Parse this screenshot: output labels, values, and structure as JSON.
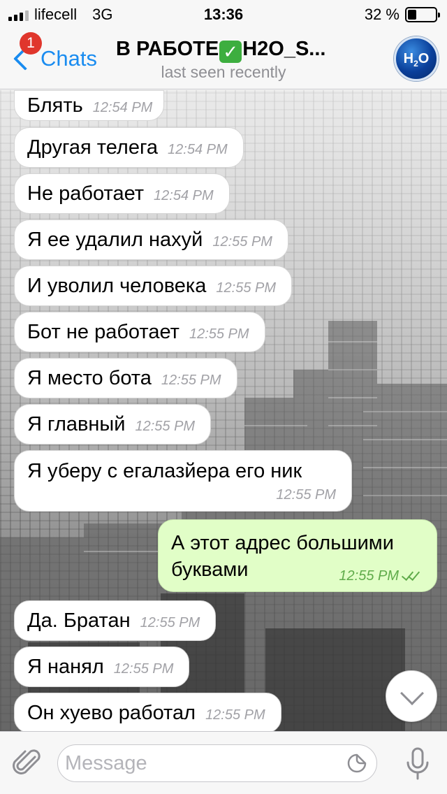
{
  "status_bar": {
    "carrier": "lifecell",
    "network": "3G",
    "time": "13:36",
    "battery": "32 %",
    "battery_level": 0.32
  },
  "header": {
    "back_label": "Chats",
    "unread_badge": "1",
    "title_before": "В РАБОТЕ",
    "title_after": "H2O_S...",
    "subtitle": "last seen recently",
    "avatar_text": "H",
    "avatar_sub": "2",
    "avatar_text2": "O"
  },
  "messages": [
    {
      "direction": "in",
      "text": "Блять",
      "time": "12:54 PM"
    },
    {
      "direction": "in",
      "text": "Другая телега",
      "time": "12:54 PM"
    },
    {
      "direction": "in",
      "text": "Не работает",
      "time": "12:54 PM"
    },
    {
      "direction": "in",
      "text": "Я ее удалил нахуй",
      "time": "12:55 PM"
    },
    {
      "direction": "in",
      "text": "И уволил человека",
      "time": "12:55 PM"
    },
    {
      "direction": "in",
      "text": "Бот не работает",
      "time": "12:55 PM"
    },
    {
      "direction": "in",
      "text": "Я место бота",
      "time": "12:55 PM"
    },
    {
      "direction": "in",
      "text": "Я главный",
      "time": "12:55 PM"
    },
    {
      "direction": "in",
      "text": "Я уберу с егалазйера его ник",
      "time": "12:55 PM"
    },
    {
      "direction": "out",
      "text_line1": "А этот адрес большими",
      "text_line2": "буквами",
      "time": "12:55 PM",
      "status": "read"
    },
    {
      "direction": "in",
      "text": "Да. Братан",
      "time": "12:55 PM"
    },
    {
      "direction": "in",
      "text": "Я нанял",
      "time": "12:55 PM"
    },
    {
      "direction": "in",
      "text": "Он хуево работал",
      "time": "12:55 PM"
    }
  ],
  "composer": {
    "placeholder": "Message"
  },
  "icons": {
    "back": "chevron-left-icon",
    "attach": "paperclip-icon",
    "sticker": "sticker-icon",
    "mic": "microphone-icon",
    "scroll_down": "chevron-down-icon",
    "read_status": "double-check-icon",
    "title_emoji": "check-mark-button-emoji"
  },
  "colors": {
    "accent": "#1a8cf0",
    "badge": "#e0362c",
    "outgoing_bubble": "#e1fec7",
    "outgoing_time": "#5fab4a",
    "incoming_bubble": "#ffffff",
    "check_emoji": "#3dae3f"
  }
}
